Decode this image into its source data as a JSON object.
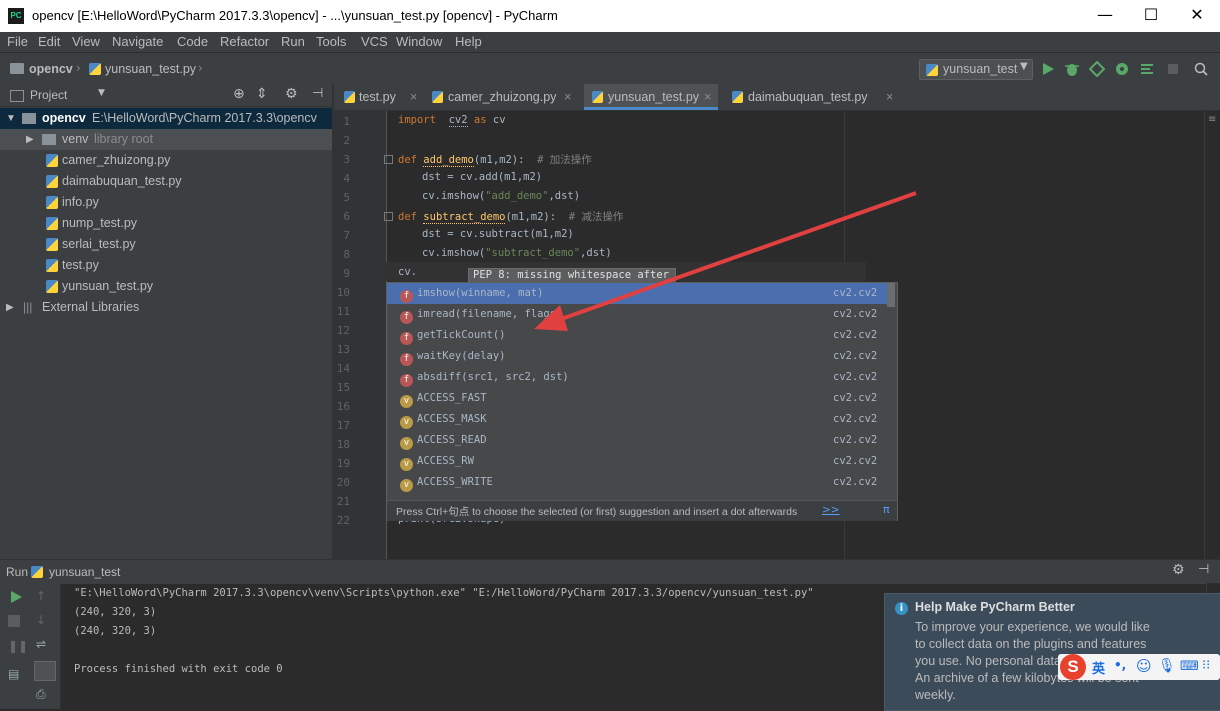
{
  "window": {
    "title": "opencv [E:\\HelloWord\\PyCharm 2017.3.3\\opencv] - ...\\yunsuan_test.py [opencv] - PyCharm",
    "app_icon": "PC",
    "minimize": "—",
    "maximize": "☐",
    "close": "✕"
  },
  "menu": {
    "items": [
      "File",
      "Edit",
      "View",
      "Navigate",
      "Code",
      "Refactor",
      "Run",
      "Tools",
      "VCS",
      "Window",
      "Help"
    ]
  },
  "navbar": {
    "breadcrumb_project": "opencv",
    "breadcrumb_file": "yunsuan_test.py",
    "run_config": "yunsuan_test"
  },
  "project_panel": {
    "title": "Project",
    "root_name": "opencv",
    "root_path": "E:\\HelloWord\\PyCharm 2017.3.3\\opencv",
    "venv_name": "venv",
    "venv_label": "library root",
    "files": [
      "camer_zhuizong.py",
      "daimabuquan_test.py",
      "info.py",
      "nump_test.py",
      "serlai_test.py",
      "test.py",
      "yunsuan_test.py"
    ],
    "external": "External Libraries"
  },
  "tabs": [
    "test.py",
    "camer_zhuizong.py",
    "yunsuan_test.py",
    "daimabuquan_test.py"
  ],
  "editor": {
    "line_numbers": [
      "1",
      "2",
      "3",
      "4",
      "5",
      "6",
      "7",
      "8",
      "9",
      "10",
      "11",
      "12",
      "13",
      "14",
      "15",
      "16",
      "17",
      "18",
      "19",
      "20",
      "21",
      "22"
    ],
    "l1_import": "import",
    "l1_mod": "cv2",
    "l1_as": "as",
    "l1_alias": "cv",
    "l3_def": "def",
    "l3_name": "add_demo",
    "l3_args": "(m1,m2):",
    "l3_comment": "# 加法操作",
    "l4": "dst = cv.add(m1,m2)",
    "l5_a": "cv.imshow(",
    "l5_str": "\"add_demo\"",
    "l5_b": ",dst)",
    "l6_def": "def",
    "l6_name": "subtract_demo",
    "l6_args": "(m1,m2):",
    "l6_comment": "# 减法操作",
    "l7": "dst = cv.subtract(m1,m2)",
    "l8_a": "cv.imshow(",
    "l8_str": "\"subtract_demo\"",
    "l8_b": ",dst)",
    "l9": "cv.",
    "l22": "print(src2.shape)",
    "tooltip_partial": "PEP 8: missing whitespace after ','"
  },
  "completion": {
    "items": [
      {
        "kind": "f",
        "name": "imshow(winname, mat)",
        "module": "cv2.cv2"
      },
      {
        "kind": "f",
        "name": "imread(filename, flags)",
        "module": "cv2.cv2"
      },
      {
        "kind": "f",
        "name": "getTickCount()",
        "module": "cv2.cv2"
      },
      {
        "kind": "f",
        "name": "waitKey(delay)",
        "module": "cv2.cv2"
      },
      {
        "kind": "f",
        "name": "absdiff(src1, src2, dst)",
        "module": "cv2.cv2"
      },
      {
        "kind": "v",
        "name": "ACCESS_FAST",
        "module": "cv2.cv2"
      },
      {
        "kind": "v",
        "name": "ACCESS_MASK",
        "module": "cv2.cv2"
      },
      {
        "kind": "v",
        "name": "ACCESS_READ",
        "module": "cv2.cv2"
      },
      {
        "kind": "v",
        "name": "ACCESS_RW",
        "module": "cv2.cv2"
      },
      {
        "kind": "v",
        "name": "ACCESS_WRITE",
        "module": "cv2.cv2"
      }
    ],
    "footer": "Press Ctrl+句点 to choose the selected (or first) suggestion and insert a dot afterwards",
    "footer_link": ">>",
    "pi": "π"
  },
  "run_panel": {
    "label": "Run",
    "config": "yunsuan_test",
    "output": [
      "\"E:\\HelloWord\\PyCharm 2017.3.3\\opencv\\venv\\Scripts\\python.exe\" \"E:/HelloWord/PyCharm 2017.3.3/opencv/yunsuan_test.py\"",
      "(240, 320, 3)",
      "(240, 320, 3)",
      "",
      "Process finished with exit code 0"
    ]
  },
  "notification": {
    "title": "Help Make PyCharm Better",
    "body_lines": [
      "To improve your experience, we would like",
      "to collect data on the plugins and features",
      "you use. No personal data",
      "An archive of a few kilobytes will be sent",
      "weekly."
    ]
  },
  "ime": {
    "lang": "英",
    "punct": "•,"
  },
  "colors": {
    "accent": "#4a88c7",
    "arrow": "#e04040",
    "run_green": "#59a869"
  }
}
